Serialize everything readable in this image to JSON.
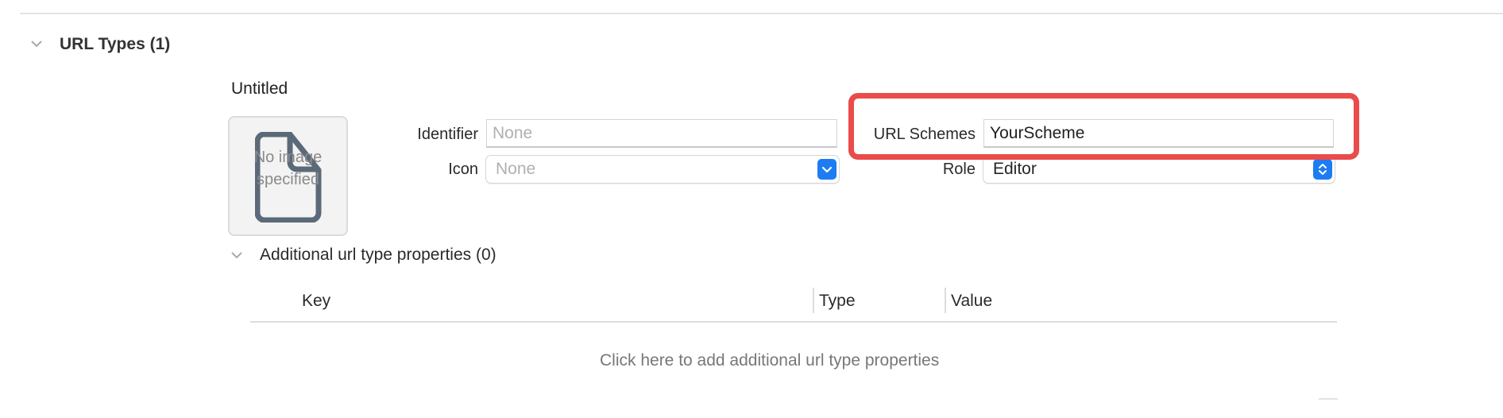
{
  "section": {
    "title": "URL Types (1)"
  },
  "url_type": {
    "name": "Untitled",
    "image_placeholder": "No image specified",
    "identifier": {
      "label": "Identifier",
      "value": "",
      "placeholder": "None"
    },
    "icon": {
      "label": "Icon",
      "value": "None"
    },
    "url_schemes": {
      "label": "URL Schemes",
      "value": "YourScheme"
    },
    "role": {
      "label": "Role",
      "value": "Editor"
    }
  },
  "additional": {
    "title": "Additional url type properties (0)",
    "columns": [
      "Key",
      "Type",
      "Value"
    ],
    "empty_hint": "Click here to add additional url type properties"
  },
  "colors": {
    "highlight": "#ea4b4b",
    "accent": "#1d7cf2"
  },
  "icons": {
    "section_disclosure": "chevron-down-icon",
    "additional_disclosure": "chevron-down-icon",
    "document": "document-icon",
    "popup": "popup-arrows-icon"
  }
}
